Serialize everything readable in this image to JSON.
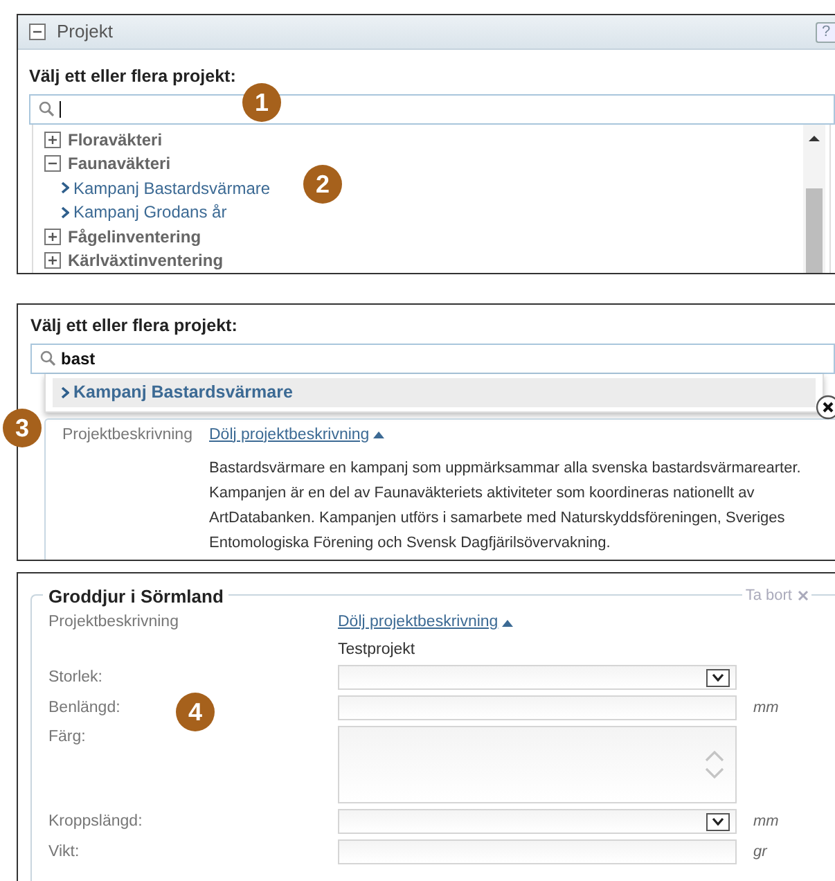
{
  "project_panel": {
    "title": "Projekt",
    "help": "?",
    "prompt": "Välj ett eller flera projekt:",
    "callout": "1",
    "tree": [
      {
        "label": "Floraväkteri",
        "expanded": false
      },
      {
        "label": "Faunaväkteri",
        "expanded": true,
        "children": [
          {
            "label": "Kampanj Bastardsvärmare",
            "callout": "2"
          },
          {
            "label": "Kampanj Grodans år"
          }
        ]
      },
      {
        "label": "Fågelinventering",
        "expanded": false
      },
      {
        "label": "Kärlväxtinventering",
        "expanded": false
      }
    ]
  },
  "search_panel": {
    "prompt": "Välj ett eller flera projekt:",
    "search": {
      "value": "bast"
    },
    "results": [
      {
        "label": "Kampanj Bastardsvärmare",
        "selected": true
      }
    ],
    "description": {
      "callout": "3",
      "label": "Projektbeskrivning",
      "toggle": "Dölj projektbeskrivning",
      "text": "Bastardsvärmare en kampanj som uppmärksammar alla svenska bastardsvärmarearter. Kampanjen är en del av Faunaväkteriets aktiviteter som koordineras nationellt av ArtDatabanken. Kampanjen utförs i samarbete med Naturskyddsföreningen, Sveriges Entomologiska Förening och Svensk Dagfjärilsövervakning."
    }
  },
  "form_panel": {
    "legend": "Groddjur i Sörmland",
    "remove": "Ta bort",
    "description_label": "Projektbeskrivning",
    "toggle": "Dölj projektbeskrivning",
    "description": "Testprojekt",
    "callout": "4",
    "fields": [
      {
        "kind": "select",
        "label": "Storlek:"
      },
      {
        "kind": "text",
        "label": "Benlängd:",
        "unit": "mm"
      },
      {
        "kind": "textarea",
        "label": "Färg:"
      },
      {
        "kind": "select",
        "label": "Kroppslängd:",
        "unit": "mm"
      },
      {
        "kind": "text",
        "label": "Vikt:",
        "unit": "gr"
      }
    ]
  }
}
